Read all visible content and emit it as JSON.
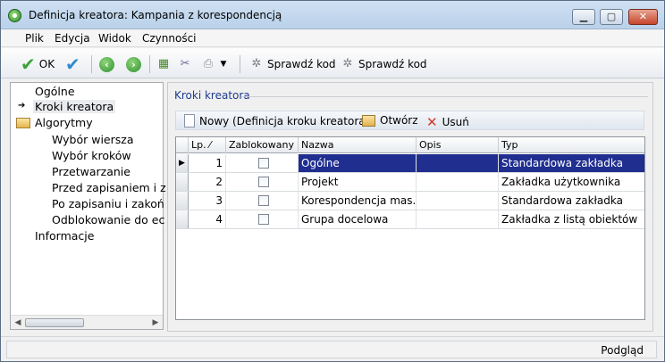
{
  "window": {
    "title": "Definicja kreatora: Kampania z korespondencją"
  },
  "menubar": [
    {
      "label": "Plik"
    },
    {
      "label": "Edycja"
    },
    {
      "label": "Widok"
    },
    {
      "label": "Czynności"
    }
  ],
  "toolbar": {
    "ok_label": "OK",
    "check_code_1": "Sprawdź kod",
    "check_code_2": "Sprawdź kod"
  },
  "tree": {
    "items": [
      {
        "label": "Ogólne",
        "level": 0
      },
      {
        "label": "Kroki kreatora",
        "level": 0,
        "current": true
      },
      {
        "label": "Algorytmy",
        "level": 0,
        "folder": true
      },
      {
        "label": "Wybór wiersza",
        "level": 1
      },
      {
        "label": "Wybór kroków",
        "level": 1
      },
      {
        "label": "Przetwarzanie",
        "level": 1
      },
      {
        "label": "Przed zapisaniem i z",
        "level": 1
      },
      {
        "label": "Po zapisaniu i zakoń",
        "level": 1
      },
      {
        "label": "Odblokowanie do ec",
        "level": 1
      },
      {
        "label": "Informacje",
        "level": 0
      }
    ]
  },
  "group": {
    "title": "Kroki kreatora"
  },
  "subtoolbar": {
    "new_label": "Nowy (Definicja kroku kreatora)",
    "open_label": "Otwórz",
    "delete_label": "Usuń"
  },
  "grid": {
    "columns": [
      "Lp. ⁄",
      "Zablokowany",
      "Nazwa",
      "Opis",
      "Typ"
    ],
    "rows": [
      {
        "lp": "1",
        "blocked": false,
        "name": "Ogólne",
        "desc": "",
        "type": "Standardowa zakładka",
        "selected": true
      },
      {
        "lp": "2",
        "blocked": false,
        "name": "Projekt",
        "desc": "",
        "type": "Zakładka użytkownika"
      },
      {
        "lp": "3",
        "blocked": false,
        "name": "Korespondencja mas...",
        "desc": "",
        "type": "Standardowa zakładka"
      },
      {
        "lp": "4",
        "blocked": false,
        "name": "Grupa docelowa",
        "desc": "",
        "type": "Zakładka z listą obiektów"
      }
    ]
  },
  "status": {
    "text": "Podgląd"
  },
  "colors": {
    "selection": "#1f2e8f",
    "group_title": "#1e3c8c",
    "ok_green": "#3aa33a"
  }
}
